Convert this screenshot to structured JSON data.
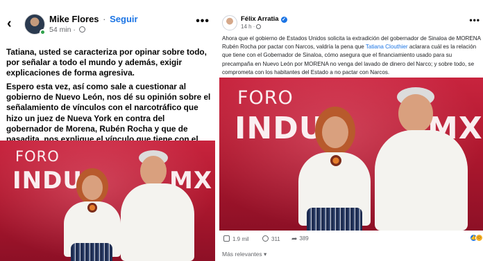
{
  "left_post": {
    "author": "Mike Flores",
    "separator": "·",
    "follow_label": "Seguir",
    "time": "54 min ·",
    "paragraph1": "Tatiana, usted se caracteriza por opinar sobre todo, por señalar a todo el mundo y además, exigir explicaciones de forma agresiva.",
    "paragraph2": "Espero esta vez, así como sale a cuestionar al gobierno de Nuevo León, nos dé su opinión sobre el señalamiento de vínculos con el narcotráfico que hizo un juez de Nueva York en contra del gobernador de Morena, Rubén Rocha y que de pasadita, nos explique el vínculo que tiene con el acusado.",
    "photo": {
      "logo_line1": "FORO",
      "logo_line2": "INDUS",
      "logo_suffix": "MX"
    }
  },
  "right_post": {
    "author": "Félix Arratia",
    "time": "14 h ·",
    "text_before_mention": "Ahora que el gobierno de Estados Unidos solicita la extradición del gobernador de Sinaloa de MORENA Rubén Rocha por pactar con Narcos, valdría la pena que ",
    "mention": "Tatiana Clouthier",
    "text_after_mention": " aclarara cuál es la relación que tiene con el Gobernador de Sinaloa, cómo asegura que el financiamiento usado para su precampaña en Nuevo León por MORENA no venga del lavado de dinero del Narco;  y sobre todo, se comprometa con los habitantes del Estado a no pactar con Narcos.",
    "photo": {
      "logo_line1": "FORO",
      "logo_line2": "INDUS",
      "logo_suffix": "MX"
    },
    "likes": "1.9 mil",
    "comments": "311",
    "shares": "389",
    "sort_label": "Más relevantes"
  },
  "icons": {
    "back": "chevron-left-icon",
    "more": "more-horizontal-icon",
    "globe": "globe-icon",
    "verified": "verified-badge-icon",
    "like": "thumbs-up-icon",
    "comment": "comment-icon",
    "share": "share-icon"
  },
  "colors": {
    "link_blue": "#1b74e4",
    "stage_red": "#b0182f",
    "meta_gray": "#65676b"
  }
}
